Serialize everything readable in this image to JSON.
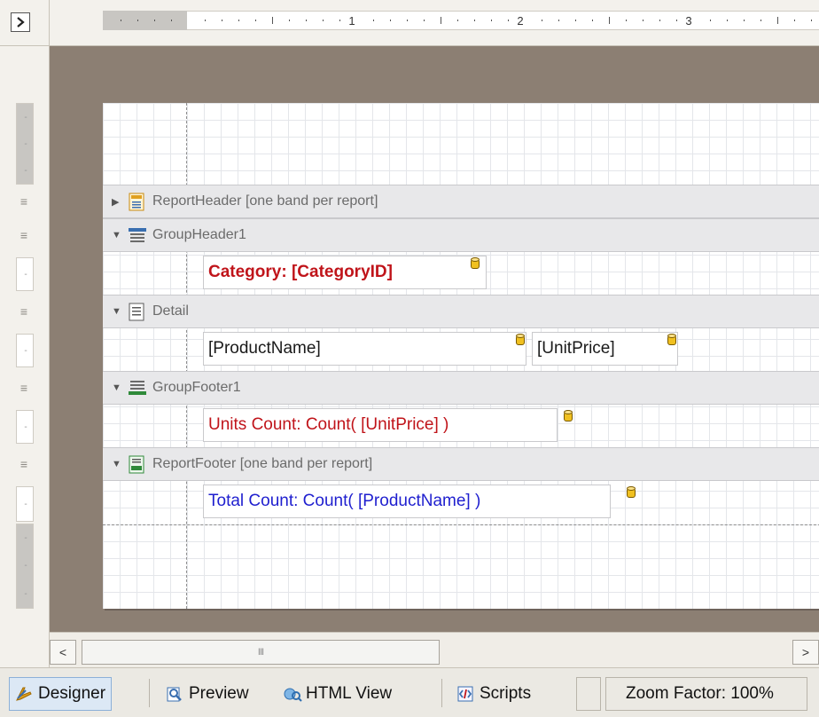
{
  "ruler_top": {
    "numbers": [
      "1",
      "2",
      "3"
    ]
  },
  "bands": [
    {
      "label": "ReportHeader [one band per report]",
      "arrow": "▶",
      "icon": "report-header-icon",
      "icon_color": "#e0a020"
    },
    {
      "label": "GroupHeader1",
      "arrow": "▼",
      "icon": "group-header-icon",
      "icon_color": "#3a6fb0"
    },
    {
      "label": "Detail",
      "arrow": "▼",
      "icon": "detail-icon",
      "icon_color": "#5a5a5a"
    },
    {
      "label": "GroupFooter1",
      "arrow": "▼",
      "icon": "group-footer-icon",
      "icon_color": "#2f8a3a"
    },
    {
      "label": "ReportFooter [one band per report]",
      "arrow": "▼",
      "icon": "report-footer-icon",
      "icon_color": "#2f8a3a"
    }
  ],
  "fields": {
    "category": "Category: [CategoryID]",
    "product_name": "[ProductName]",
    "unit_price": "[UnitPrice]",
    "units_count": "Units Count: Count( [UnitPrice] )",
    "total_count": "Total Count: Count( [ProductName] )"
  },
  "colors": {
    "canvas_bg": "#8c7f73",
    "band_header_bg": "#e8e8ea",
    "red": "#c0141a",
    "blue": "#1f1fcf",
    "active_tab": "#dce8f5"
  },
  "scrollbar": {
    "left": "<",
    "right": ">",
    "grip": "III"
  },
  "tabs": {
    "designer": "Designer",
    "preview": "Preview",
    "html_view": "HTML View",
    "scripts": "Scripts"
  },
  "zoom": {
    "label": "Zoom Factor: 100%"
  },
  "corner": {
    "toggle": "⊡"
  }
}
